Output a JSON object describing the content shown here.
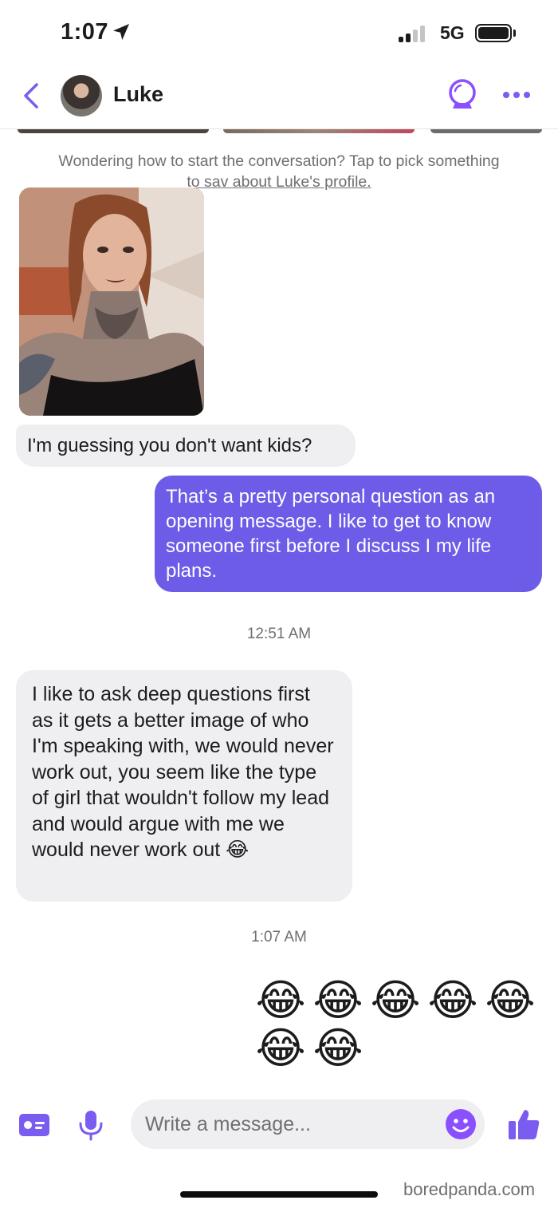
{
  "status": {
    "time": "1:07",
    "network": "5G"
  },
  "header": {
    "contact_name": "Luke"
  },
  "hint": {
    "line1": "Wondering how to start the conversation? Tap to pick something",
    "line2": "to sav about Luke's profile."
  },
  "messages": [
    {
      "direction": "incoming",
      "text": "I'm guessing you don't want kids?"
    },
    {
      "direction": "outgoing",
      "text": "That’s a pretty personal question as an opening message. I like to get to know someone first before I discuss I my life plans."
    },
    {
      "direction": "incoming",
      "text": "I like to ask deep questions first as it gets a better image of who I'm speaking with, we would never work out, you seem like the type of girl that wouldn't follow my lead and would argue with me we would never work out 😂"
    }
  ],
  "timestamps": [
    "12:51 AM",
    "1:07 AM"
  ],
  "emoji_messages": [
    "😂",
    "😂",
    "😂",
    "😂",
    "😂",
    "😂",
    "😂"
  ],
  "composer": {
    "placeholder": "Write a message..."
  },
  "watermark": "boredpanda.com",
  "colors": {
    "accent": "#7b5cf0",
    "outgoing_bubble": "#6c5ce7",
    "incoming_bubble": "#efeff1"
  }
}
